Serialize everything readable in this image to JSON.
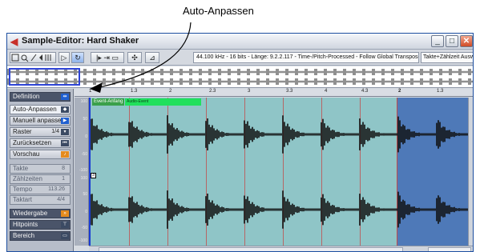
{
  "callout": {
    "label": "Auto-Anpassen"
  },
  "window": {
    "title": "Sample-Editor: Hard Shaker",
    "controls": {
      "minimize": "_",
      "maximize": "□",
      "close": "✕"
    }
  },
  "toolbar": {
    "tools": [
      "select-range-icon",
      "zoom-icon",
      "pencil-icon",
      "play-icon",
      "scrub-icon",
      "hitpoint-icon"
    ],
    "info": "44.100 kHz - 16 bits - Länge: 9.2.2.117 - Time-/Pitch-Processed - Follow Global Transpose",
    "info2": "Takte+Zählzeit  Ausw"
  },
  "ruler": {
    "ticks": [
      {
        "label": "1",
        "major": true
      },
      {
        "label": "1.3",
        "major": false
      },
      {
        "label": "2",
        "major": false
      },
      {
        "label": "2.3",
        "major": false
      },
      {
        "label": "3",
        "major": false
      },
      {
        "label": "3.3",
        "major": false
      },
      {
        "label": "4",
        "major": false
      },
      {
        "label": "4.3",
        "major": false
      },
      {
        "label": "2",
        "major": true
      },
      {
        "label": "1.3",
        "major": false
      }
    ]
  },
  "inspector": {
    "definition": "Definition",
    "auto_adjust": "Auto-Anpassen",
    "manual_adjust": "Manuell anpasse",
    "raster": {
      "label": "Raster",
      "value": "1/4"
    },
    "reset": "Zurücksetzen",
    "preview": "Vorschau",
    "bars": {
      "label": "Takte",
      "value": "8"
    },
    "beats": {
      "label": "Zählzeiten",
      "value": "1"
    },
    "tempo": {
      "label": "Tempo",
      "value": "113.26"
    },
    "signature": {
      "label": "Taktart",
      "value": "4/4"
    },
    "playback": "Wiedergabe",
    "hitpoints": "Hitpoints",
    "range": "Bereich"
  },
  "scale_labels": [
    "100",
    "50",
    "0",
    "-50",
    "-100",
    "100",
    "50",
    "0",
    "-50",
    "-100"
  ],
  "editor": {
    "event_label": "Event-Anfang",
    "event_label2": "Audio-Event",
    "marker": "3"
  },
  "colors": {
    "wave_bg": "#8fc5c7",
    "selection": "#4e79b8",
    "waveform": "#101010",
    "cursor": "#1a3bd5"
  }
}
